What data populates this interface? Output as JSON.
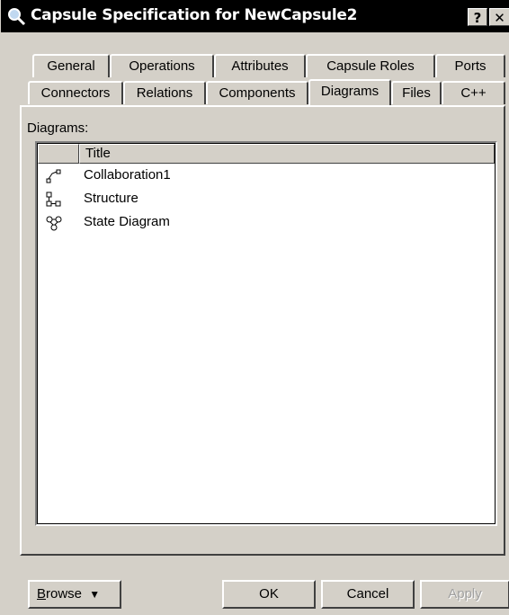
{
  "window": {
    "title": "Capsule Specification for NewCapsule2",
    "help_label": "?",
    "close_label": "✕"
  },
  "tabs": {
    "row1": [
      "General",
      "Operations",
      "Attributes",
      "Capsule Roles",
      "Ports"
    ],
    "row2": [
      "Connectors",
      "Relations",
      "Components",
      "Diagrams",
      "Files",
      "C++"
    ],
    "active": "Diagrams"
  },
  "diagrams": {
    "label": "Diagrams:",
    "column_title": "Title",
    "rows": [
      {
        "title": "Collaboration1",
        "icon": "collaboration-diagram-icon"
      },
      {
        "title": "Structure",
        "icon": "structure-diagram-icon"
      },
      {
        "title": "State Diagram",
        "icon": "state-diagram-icon"
      }
    ]
  },
  "buttons": {
    "browse": "Browse",
    "browse_arrow": "▼",
    "ok": "OK",
    "cancel": "Cancel",
    "apply": "Apply"
  },
  "colors": {
    "face": "#d4d0c8",
    "titlebar": "#000000",
    "list_bg": "#ffffff",
    "disabled_text": "#a0a0a0"
  }
}
